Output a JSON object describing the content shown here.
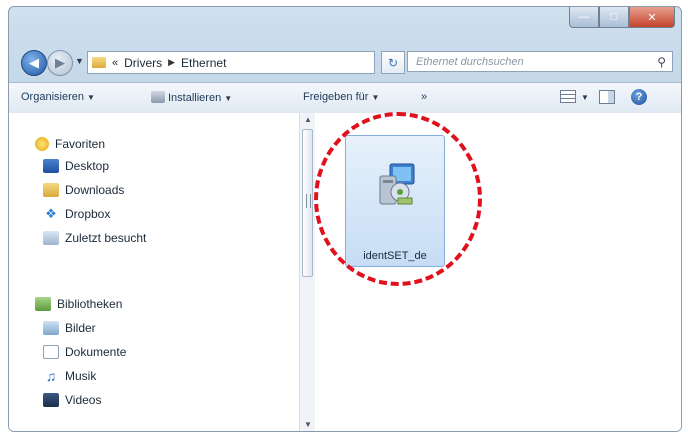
{
  "window": {
    "caption_buttons": {
      "minimize_icon": "minimize-icon",
      "maximize_icon": "maximize-icon",
      "close_icon": "close-icon"
    }
  },
  "address": {
    "overflow": "«",
    "breadcrumb": [
      "Drivers",
      "Ethernet"
    ],
    "search_placeholder": "Ethernet durchsuchen"
  },
  "toolbar": {
    "organize": "Organisieren",
    "install": "Installieren",
    "share": "Freigeben für",
    "more": "»"
  },
  "sidebar": {
    "favorites_header": "Favoriten",
    "favorites": [
      "Desktop",
      "Downloads",
      "Dropbox",
      "Zuletzt besucht"
    ],
    "libraries_header": "Bibliotheken",
    "libraries": [
      "Bilder",
      "Dokumente",
      "Musik",
      "Videos"
    ]
  },
  "files": [
    {
      "name": "identSET_de",
      "icon": "installer-icon",
      "selected": true
    }
  ],
  "colors": {
    "highlight_ring": "#e0101c",
    "selection_fill": "#c6ddf5"
  }
}
